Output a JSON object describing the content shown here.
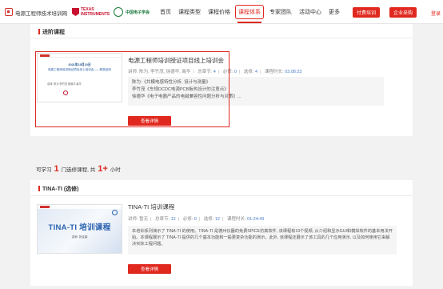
{
  "header": {
    "site_name": "电源工程师技术培训网",
    "ti_logo_text": "TEXAS\nINSTRUMENTS",
    "university_logo_text": "中国电子学会",
    "nav": [
      {
        "label": "首页"
      },
      {
        "label": "课程类型"
      },
      {
        "label": "课程价格"
      },
      {
        "label": "课程体系",
        "active": true
      },
      {
        "label": "专家团队"
      },
      {
        "label": "活动中心"
      },
      {
        "label": "更多"
      }
    ],
    "paid_training_label": "付费培训",
    "corporate_purchase_label": "企业采购",
    "login_label": "登录"
  },
  "advanced": {
    "section_title": "进阶课程",
    "course": {
      "title": "电源工程师培训授证项目线上培训会",
      "meta": {
        "speaker_label": "讲师:",
        "speakers": "陈为, 李竹茂, 徐德华, 禹华",
        "lecture_count_label": "总章节:",
        "lecture_count": "4",
        "required_label": "必修:",
        "required": "0",
        "elective_label": "选修:",
        "elective": "4",
        "duration_label": "课程时长:",
        "duration": "03:08:23"
      },
      "description_lines": [
        "陈为:《共模电感特性分析, 设计与测量》",
        "李竹茂《车规DCDC电源PCB板热设计的注意点》",
        "徐德华《电子电器产品的电磁兼容性问题分析与对策》..."
      ],
      "detail_button": "查看详情",
      "thumbnail": {
        "date_text": "2021年10月10日",
        "title_text": "电源工程师培训授证项目线上培训会——精英回流",
        "info_text": "讲师: 陈为 李竹茂 徐德华 禹华"
      }
    }
  },
  "summary": {
    "prefix": "可学习",
    "course_count": "1",
    "middle": "门选修课程, 共",
    "hours": "1+",
    "suffix": "小时"
  },
  "tina": {
    "section_title": "TINA-TI (选修)",
    "course": {
      "title": "TINA-TI 培训课程",
      "meta": {
        "speaker_label": "讲师:",
        "speakers": "暂无",
        "lecture_count_label": "总章节:",
        "lecture_count": "12",
        "required_label": "必修:",
        "required": "0",
        "elective_label": "选修:",
        "elective": "12",
        "duration_label": "课程时长:",
        "duration": "01:24:49"
      },
      "description": "本培训系列演示了 TINA-TI 的使用。TINA-TI 是德州仪器的免费SPICE仿真软件, 该课程有19个视频, 从介绍和显示GUI和模拟软件的基本用法开始。本课程展示了 TINA-TI 提供的几个基本功能和一般更复杂功能的演示。此外, 该课程还展示了该工具的几个应用演示, 以及如何使用它来解决实际工程问题。",
      "detail_button": "查看详情",
      "thumbnail": {
        "title_text": "TINA-TI 培训课程",
        "speaker_text": "讲师: 张佳豪"
      }
    }
  }
}
